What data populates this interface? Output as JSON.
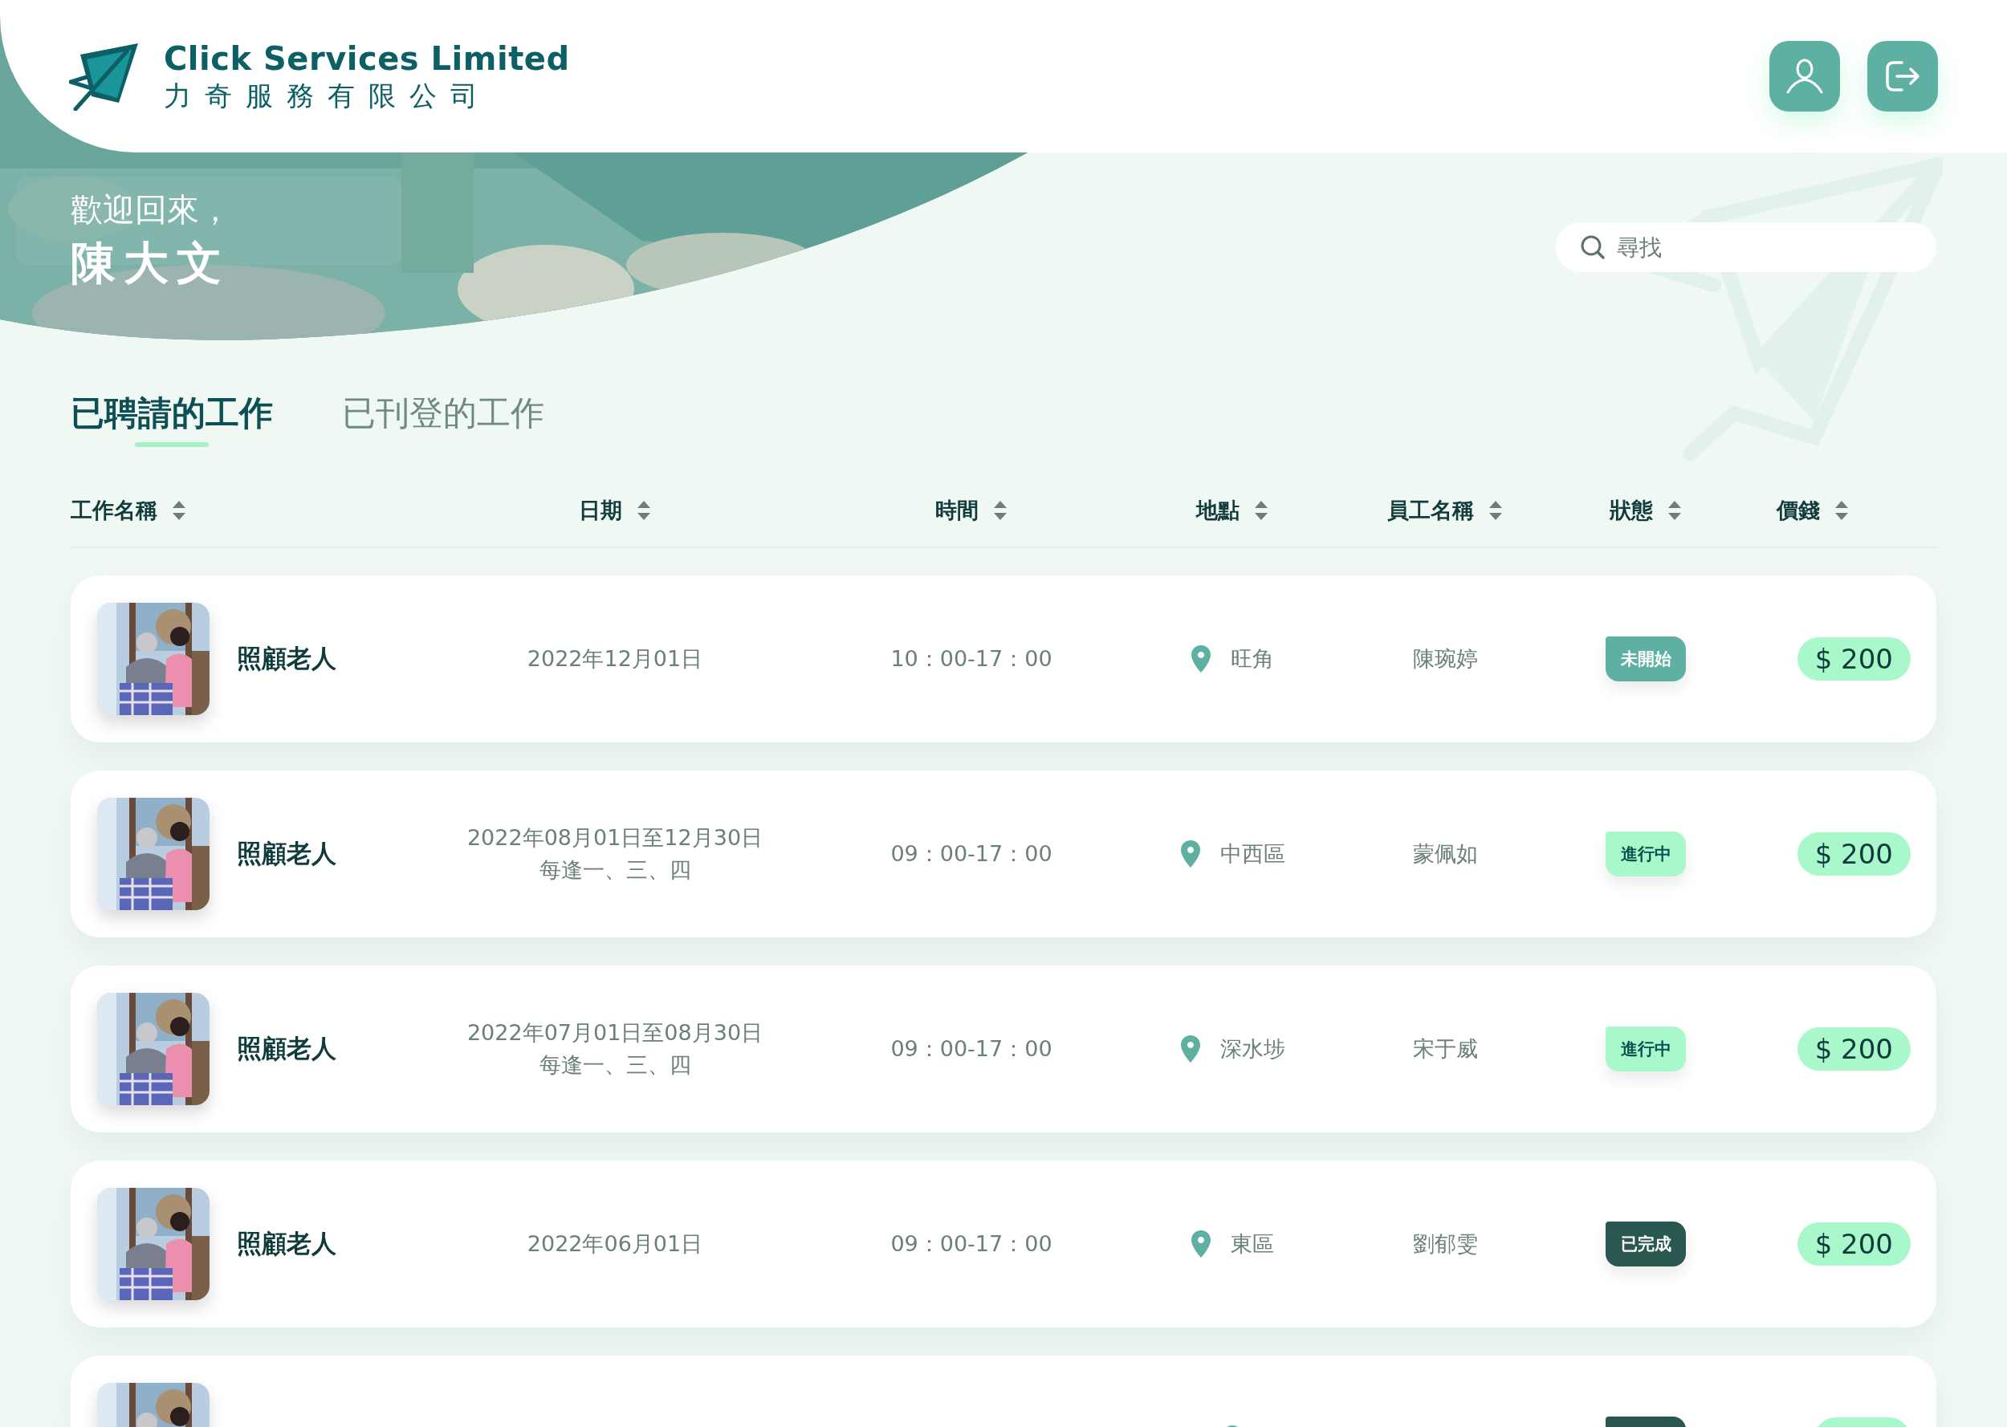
{
  "brand": {
    "name_en": "Click Services Limited",
    "name_zh": "力奇服務有限公司"
  },
  "welcome": {
    "greeting": "歡迎回來，",
    "user": "陳大文"
  },
  "search": {
    "placeholder": "尋找"
  },
  "tabs": [
    {
      "label": "已聘請的工作",
      "selected": true
    },
    {
      "label": "已刊登的工作",
      "selected": false
    }
  ],
  "table": {
    "columns": [
      "工作名稱",
      "日期",
      "時間",
      "地點",
      "員工名稱",
      "狀態",
      "價錢"
    ],
    "rows": [
      {
        "job": "照顧老人",
        "date": [
          "2022年12月01日"
        ],
        "time": "10：00-17：00",
        "location": "旺角",
        "employee": "陳琬婷",
        "status": {
          "kind": "not_started",
          "label": "未開始"
        },
        "price": "$ 200"
      },
      {
        "job": "照顧老人",
        "date": [
          "2022年08月01日至12月30日",
          "每逢一、三、四"
        ],
        "time": "09：00-17：00",
        "location": "中西區",
        "employee": "蒙佩如",
        "status": {
          "kind": "in_progress",
          "label": "進行中"
        },
        "price": "$ 200"
      },
      {
        "job": "照顧老人",
        "date": [
          "2022年07月01日至08月30日",
          "每逢一、三、四"
        ],
        "time": "09：00-17：00",
        "location": "深水埗",
        "employee": "宋于威",
        "status": {
          "kind": "in_progress",
          "label": "進行中"
        },
        "price": "$ 200"
      },
      {
        "job": "照顧老人",
        "date": [
          "2022年06月01日"
        ],
        "time": "09：00-17：00",
        "location": "東區",
        "employee": "劉郁雯",
        "status": {
          "kind": "done",
          "label": "已完成"
        },
        "price": "$ 200"
      }
    ],
    "partial_row": {
      "status": {
        "kind": "done"
      }
    }
  }
}
